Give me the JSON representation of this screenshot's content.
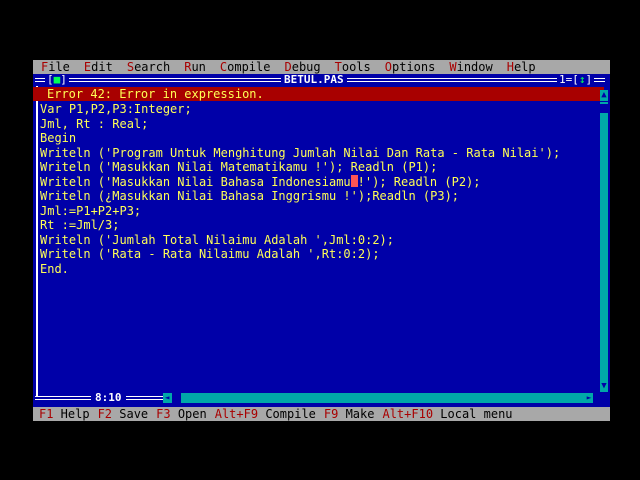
{
  "menubar": {
    "items": [
      {
        "hot": "F",
        "rest": "ile"
      },
      {
        "hot": "E",
        "rest": "dit"
      },
      {
        "hot": "S",
        "rest": "earch"
      },
      {
        "hot": "R",
        "rest": "un"
      },
      {
        "hot": "C",
        "rest": "ompile"
      },
      {
        "hot": "D",
        "rest": "ebug"
      },
      {
        "hot": "T",
        "rest": "ools"
      },
      {
        "hot": "O",
        "rest": "ptions"
      },
      {
        "hot": "W",
        "rest": "indow"
      },
      {
        "hot": "H",
        "rest": "elp"
      }
    ]
  },
  "window": {
    "title": "BETUL.PAS",
    "close_box": "[",
    "close_box_inner": "■",
    "close_box_end": "]",
    "number": "1",
    "controls_open": "=[",
    "controls_inner": "↕",
    "controls_close": "]",
    "cursor_position": "8:10",
    "scroll_up": "▲",
    "scroll_down": "▼",
    "scroll_left": "◄",
    "scroll_right": "►"
  },
  "error": {
    "message": "Error 42: Error in expression."
  },
  "code": {
    "lines": [
      "Var P1,P2,P3:Integer;",
      "Jml, Rt : Real;",
      "Begin",
      "Writeln ('Program Untuk Menghitung Jumlah Nilai Dan Rata - Rata Nilai');",
      "Writeln ('Masukkan Nilai Matematikamu !'); Readln (P1);",
      "Writeln ('Masukkan Nilai Bahasa Indonesiamu !'); Readln (P2);",
      "Writeln (¿Masukkan Nilai Bahasa Inggrismu !');Readln (P3);",
      "Jml:=P1+P2+P3;",
      "Rt :=Jml/3;",
      "Writeln ('Jumlah Total Nilaimu Adalah ',Jml:0:2);",
      "Writeln ('Rata - Rata Nilaimu Adalah ',Rt:0:2);",
      "End."
    ],
    "cursor_line_before": "Writeln ('Masukkan Nilai Bahasa Indonesiamu",
    "cursor_line_after": "!'); Readln (P2);"
  },
  "statusbar": {
    "items": [
      {
        "key": "F1",
        "label": " Help"
      },
      {
        "key": "F2",
        "label": " Save"
      },
      {
        "key": "F3",
        "label": " Open"
      },
      {
        "key": "Alt+F9",
        "label": " Compile"
      },
      {
        "key": "F9",
        "label": " Make"
      },
      {
        "key": "Alt+F10",
        "label": " Local menu"
      }
    ]
  },
  "colors": {
    "editor_bg": "#0000a8",
    "code_text": "#ffff55",
    "menu_bg": "#a8a8a8",
    "hotkey": "#a80000",
    "error_bg": "#a80000",
    "error_text": "#ffff55",
    "scrollbar": "#00a8a8",
    "cursor": "#ff5555"
  }
}
